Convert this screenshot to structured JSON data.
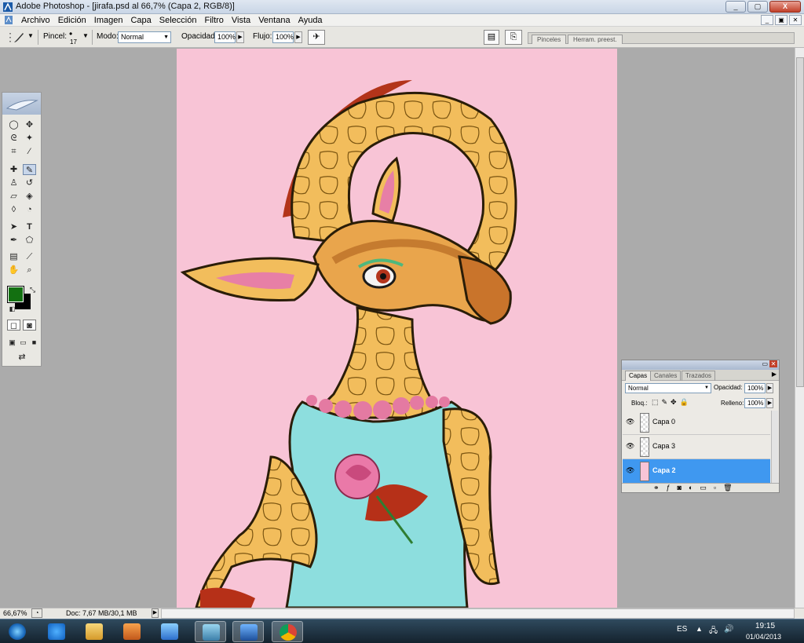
{
  "window": {
    "title": "Adobe Photoshop - [jirafa.psd al 66,7% (Capa 2, RGB/8)]",
    "min": "_",
    "max": "▢",
    "close": "X"
  },
  "menu": {
    "items": [
      "Archivo",
      "Edición",
      "Imagen",
      "Capa",
      "Selección",
      "Filtro",
      "Vista",
      "Ventana",
      "Ayuda"
    ]
  },
  "options": {
    "brush_label": "Pincel:",
    "brush_size": "17",
    "mode_label": "Modo:",
    "mode_value": "Normal",
    "opacity_label": "Opacidad:",
    "opacity_value": "100%",
    "flow_label": "Flujo:",
    "flow_value": "100%"
  },
  "palette_well": {
    "tabs": [
      "Pinceles",
      "Herram. preest."
    ]
  },
  "layers_panel": {
    "tabs": [
      "Capas",
      "Canales",
      "Trazados"
    ],
    "blend_mode": "Normal",
    "opacity_label": "Opacidad:",
    "opacity_value": "100%",
    "lock_label": "Bloq.:",
    "fill_label": "Relleno:",
    "fill_value": "100%",
    "layers": [
      {
        "name": "Capa 0",
        "selected": false
      },
      {
        "name": "Capa 3",
        "selected": false
      },
      {
        "name": "Capa 2",
        "selected": true
      }
    ]
  },
  "status": {
    "zoom": "66,67%",
    "doc": "Doc: 7,67 MB/30,1 MB"
  },
  "taskbar": {
    "lang": "ES",
    "time": "19:15",
    "date": "01/04/2013",
    "apps": [
      "start-orb-icon",
      "internet-explorer-icon",
      "file-explorer-icon",
      "media-player-icon",
      "painting-app-icon",
      "network-app-icon",
      "photoshop-icon",
      "chrome-icon"
    ]
  },
  "colors": {
    "foreground": "#137011",
    "background": "#000000",
    "canvas_bg": "#f8c4d6",
    "layer_selected": "#3f98f0"
  }
}
